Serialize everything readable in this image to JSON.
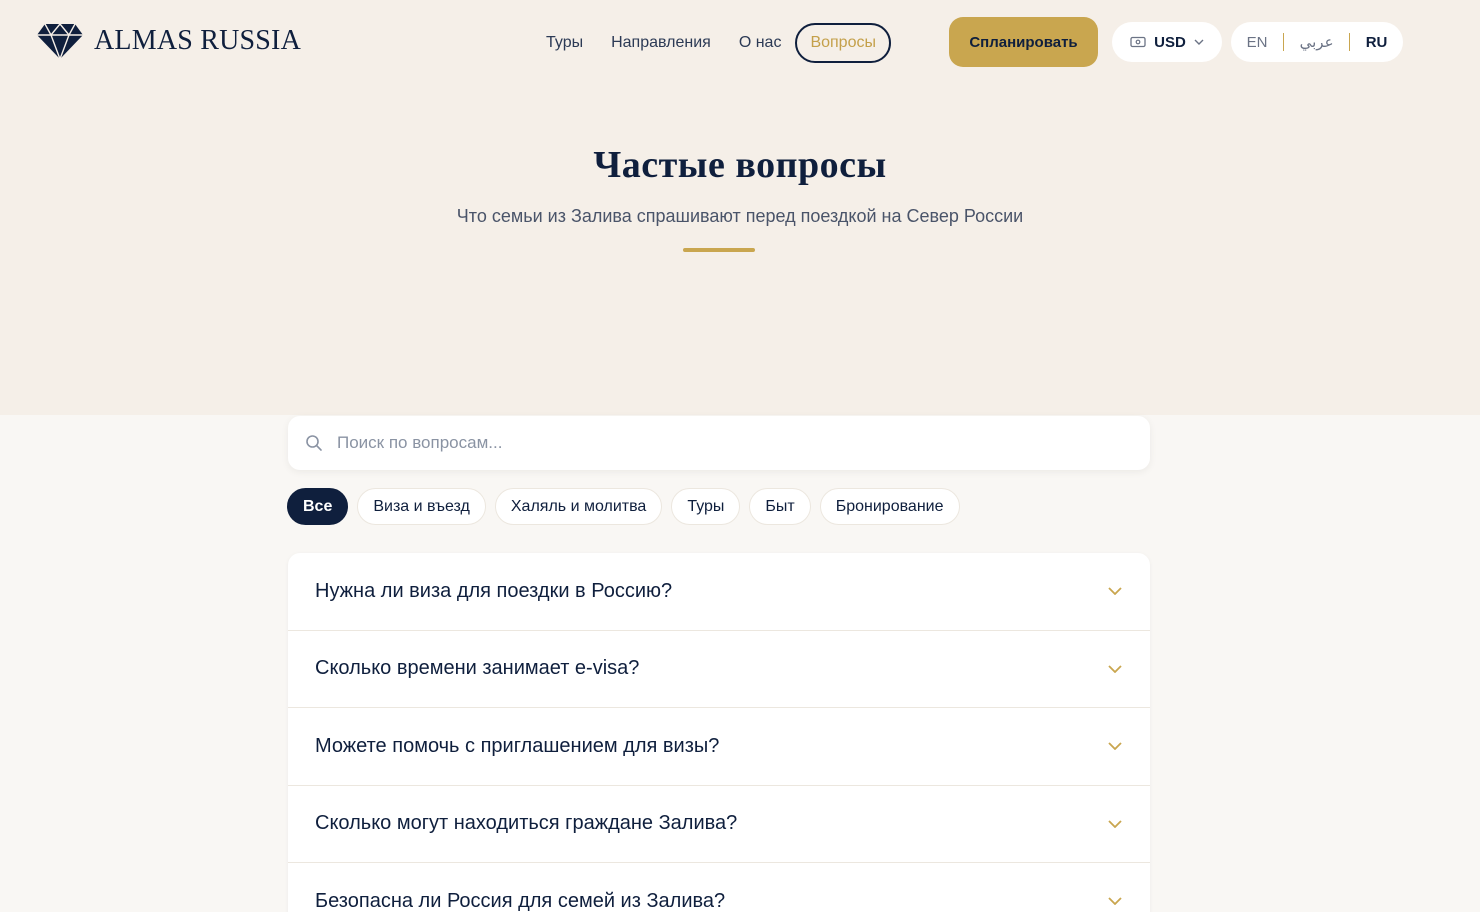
{
  "header": {
    "logo_text": "ALMAS RUSSIA",
    "nav": [
      {
        "label": "Туры"
      },
      {
        "label": "Направления"
      },
      {
        "label": "О нас"
      },
      {
        "label": "Вопросы",
        "active": true
      }
    ],
    "cta_label": "Спланировать",
    "currency": {
      "label": "USD",
      "icon": "banknote-icon"
    },
    "languages": [
      {
        "label": "EN"
      },
      {
        "label": "عربي"
      },
      {
        "label": "RU",
        "current": true
      }
    ]
  },
  "hero": {
    "title": "Частые вопросы",
    "subtitle": "Что семьи из Залива спрашивают перед поездкой на Север России"
  },
  "search": {
    "placeholder": "Поиск по вопросам...",
    "value": ""
  },
  "filters": [
    {
      "label": "Все",
      "active": true
    },
    {
      "label": "Виза и въезд"
    },
    {
      "label": "Халяль и молитва"
    },
    {
      "label": "Туры"
    },
    {
      "label": "Быт"
    },
    {
      "label": "Бронирование"
    }
  ],
  "faq": [
    {
      "question": "Нужна ли виза для поездки в Россию?"
    },
    {
      "question": "Сколько времени занимает e-visa?"
    },
    {
      "question": "Можете помочь с приглашением для визы?"
    },
    {
      "question": "Сколько могут находиться граждане Залива?"
    },
    {
      "question": "Безопасна ли Россия для семей из Залива?"
    }
  ],
  "colors": {
    "navy": "#0f1f3d",
    "gold": "#c9a64f",
    "hero_bg": "#f5efe8",
    "page_bg": "#f9f7f4"
  }
}
